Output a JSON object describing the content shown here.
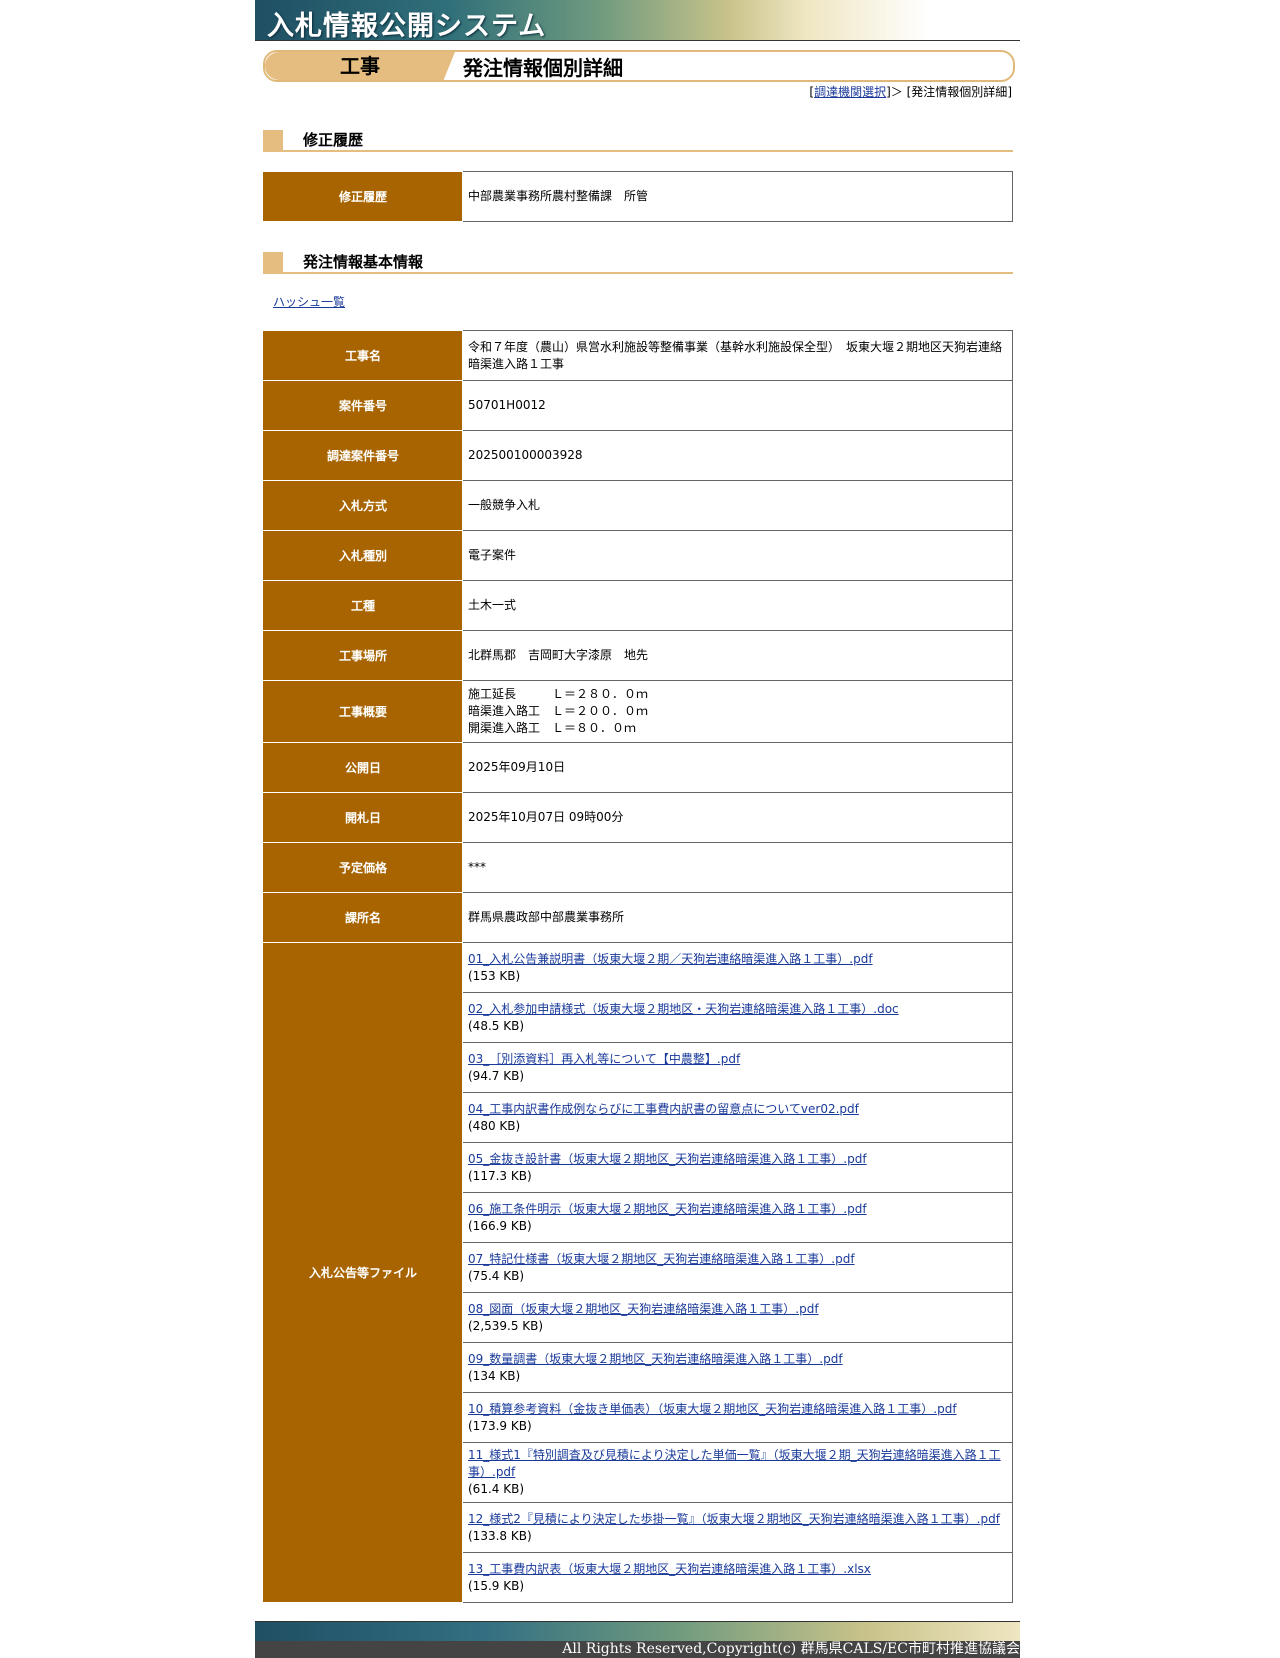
{
  "header": {
    "banner_title": "入札情報公開システム",
    "category": "工事",
    "page_title": "発注情報個別詳細"
  },
  "breadcrumb": {
    "open_bracket": "[",
    "link_label": "調達機関選択",
    "separator": "]＞ [",
    "current": "発注情報個別詳細",
    "close_bracket": "]"
  },
  "revision_section": {
    "heading": "修正履歴",
    "row_label": "修正履歴",
    "row_value": "中部農業事務所農村整備課　所管"
  },
  "basic_section": {
    "heading": "発注情報基本情報",
    "hash_link": "ハッシュ一覧",
    "rows": [
      {
        "label": "工事名",
        "value": "令和７年度（農山）県営水利施設等整備事業（基幹水利施設保全型）　坂東大堰２期地区天狗岩連絡暗渠進入路１工事"
      },
      {
        "label": "案件番号",
        "value": "50701H0012"
      },
      {
        "label": "調達案件番号",
        "value": "202500100003928"
      },
      {
        "label": "入札方式",
        "value": "一般競争入札"
      },
      {
        "label": "入札種別",
        "value": "電子案件"
      },
      {
        "label": "工種",
        "value": "土木一式"
      },
      {
        "label": "工事場所",
        "value": "北群馬郡　吉岡町大字漆原　地先"
      }
    ],
    "overview": {
      "label": "工事概要",
      "lines": [
        "施工延長　　　Ｌ＝２８０．０ｍ",
        "暗渠進入路工　Ｌ＝２００．０ｍ",
        "開渠進入路工　Ｌ＝８０．０ｍ"
      ]
    },
    "rows2": [
      {
        "label": "公開日",
        "value": "2025年09月10日"
      },
      {
        "label": "開札日",
        "value": "2025年10月07日 09時00分"
      },
      {
        "label": "予定価格",
        "value": "***"
      },
      {
        "label": "課所名",
        "value": "群馬県農政部中部農業事務所"
      }
    ],
    "files_label": "入札公告等ファイル",
    "files": [
      {
        "name": "01_入札公告兼説明書（坂東大堰２期／天狗岩連絡暗渠進入路１工事）.pdf",
        "size": "(153 KB)"
      },
      {
        "name": "02_入札参加申請様式（坂東大堰２期地区・天狗岩連絡暗渠進入路１工事）.doc",
        "size": "(48.5 KB)"
      },
      {
        "name": "03_［別添資料］再入札等について【中農整】.pdf",
        "size": "(94.7 KB)"
      },
      {
        "name": "04_工事内訳書作成例ならびに工事費内訳書の留意点についてver02.pdf",
        "size": "(480 KB)"
      },
      {
        "name": "05_金抜き設計書（坂東大堰２期地区_天狗岩連絡暗渠進入路１工事）.pdf",
        "size": "(117.3 KB)"
      },
      {
        "name": "06_施工条件明示（坂東大堰２期地区_天狗岩連絡暗渠進入路１工事）.pdf",
        "size": "(166.9 KB)"
      },
      {
        "name": "07_特記仕様書（坂東大堰２期地区_天狗岩連絡暗渠進入路１工事）.pdf",
        "size": "(75.4 KB)"
      },
      {
        "name": "08_図面（坂東大堰２期地区_天狗岩連絡暗渠進入路１工事）.pdf",
        "size": "(2,539.5 KB)"
      },
      {
        "name": "09_数量調書（坂東大堰２期地区_天狗岩連絡暗渠進入路１工事）.pdf",
        "size": "(134 KB)"
      },
      {
        "name": "10_積算参考資料（金抜き単価表）（坂東大堰２期地区_天狗岩連絡暗渠進入路１工事）.pdf",
        "size": "(173.9 KB)"
      },
      {
        "name": "11_様式1『特別調査及び見積により決定した単価一覧』（坂東大堰２期_天狗岩連絡暗渠進入路１工事）.pdf",
        "size": "(61.4 KB)"
      },
      {
        "name": "12_様式2『見積により決定した歩掛一覧』（坂東大堰２期地区_天狗岩連絡暗渠進入路１工事）.pdf",
        "size": "(133.8 KB)"
      },
      {
        "name": "13_工事費内訳表（坂東大堰２期地区_天狗岩連絡暗渠進入路１工事）.xlsx",
        "size": "(15.9 KB)"
      }
    ]
  },
  "footer": {
    "copyright": "All Rights Reserved,Copyright(c) 群馬県CALS/EC市町村推進協議会"
  }
}
